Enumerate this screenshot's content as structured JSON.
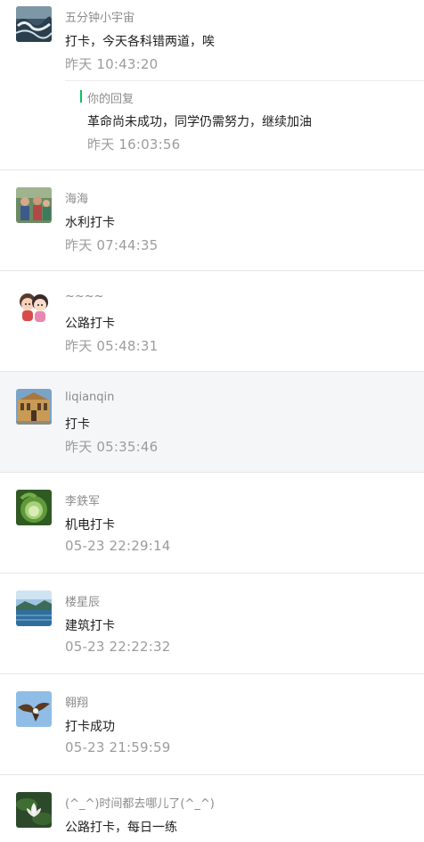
{
  "comments": [
    {
      "nickname": "五分钟小宇宙",
      "text": "打卡，今天各科错两道，唉",
      "time": "昨天 10:43:20",
      "avatar": "sea-wave-avatar",
      "reply": {
        "label": "你的回复",
        "text": "革命尚未成功，同学仍需努力，继续加油",
        "time": "昨天 16:03:56"
      }
    },
    {
      "nickname": "海海",
      "text": "水利打卡",
      "time": "昨天 07:44:35",
      "avatar": "group-photo-avatar"
    },
    {
      "nickname": "~~~~",
      "text": "公路打卡",
      "time": "昨天 05:48:31",
      "avatar": "cartoon-couple-avatar"
    },
    {
      "nickname": "liqianqin",
      "text": "打卡",
      "time": "昨天 05:35:46",
      "avatar": "building-avatar",
      "highlighted": true
    },
    {
      "nickname": "李鉄军",
      "text": "机电打卡",
      "time": "05-23 22:29:14",
      "avatar": "cabbage-avatar"
    },
    {
      "nickname": "楼星辰",
      "text": "建筑打卡",
      "time": "05-23 22:22:32",
      "avatar": "lake-landscape-avatar"
    },
    {
      "nickname": "翱翔",
      "text": "打卡成功",
      "time": "05-23 21:59:59",
      "avatar": "eagle-avatar"
    },
    {
      "nickname": "(^_^)时间都去哪儿了(^_^)",
      "text": "公路打卡，每日一练",
      "time": "",
      "avatar": "lotus-avatar"
    }
  ]
}
